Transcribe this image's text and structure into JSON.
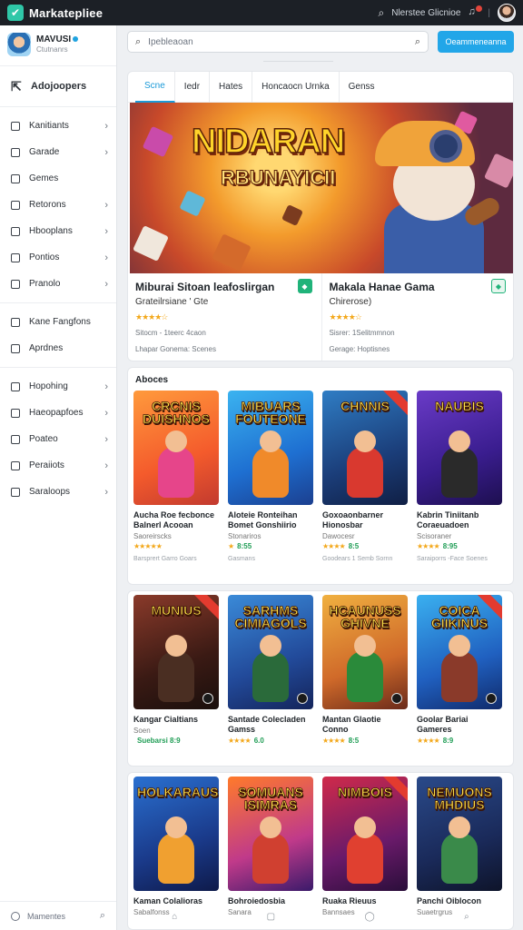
{
  "topbar": {
    "app_title": "Markatepliee",
    "user_text": "Nlerstee Glicnioe",
    "icons": [
      "search-icon",
      "bell-icon",
      "avatar"
    ],
    "accent": "#2fc7a8"
  },
  "sidebar": {
    "profile": {
      "name": "MAVUSI",
      "sub": "Ctutnanrs"
    },
    "back_label": "Adojoopers",
    "group1": [
      {
        "label": "Kanitiants",
        "chevron": true
      },
      {
        "label": "Garade",
        "chevron": true
      },
      {
        "label": "Gemes",
        "chevron": false
      },
      {
        "label": "Retorons",
        "chevron": true
      },
      {
        "label": "Hbooplans",
        "chevron": true
      },
      {
        "label": "Pontios",
        "chevron": true
      },
      {
        "label": "Pranolo",
        "chevron": true
      }
    ],
    "group2": [
      {
        "label": "Kane Fangfons",
        "chevron": false
      },
      {
        "label": "Aprdnes",
        "chevron": false
      }
    ],
    "group3": [
      {
        "label": "Hopohing",
        "chevron": true
      },
      {
        "label": "Haeopapfoes",
        "chevron": true
      },
      {
        "label": "Poateo",
        "chevron": true
      },
      {
        "label": "Peraiiots",
        "chevron": true
      },
      {
        "label": "Saraloops",
        "chevron": true
      }
    ],
    "footer_label": "Mamentes"
  },
  "search": {
    "placeholder": "Ipebleaoan",
    "button_label": "Oeammeneanna"
  },
  "subtle_text": "———————————",
  "tabs": [
    "Scne",
    "Iedr",
    "Hates",
    "Honcaocn Urnka",
    "Genss"
  ],
  "active_tab": 0,
  "hero": {
    "title": "NIDARAN",
    "subtitle": "RBUNAYICII"
  },
  "featured": [
    {
      "title": "Miburai Sitoan leafoslirgan",
      "subtitle": "Grateilrsiane ' Gte",
      "stars": "★★★★☆",
      "meta1": "Sitocm - 1teerc 4caon",
      "meta2": "Lhapar Gonema: Scenes",
      "badge": "◆"
    },
    {
      "title": "Makala Hanae Gama",
      "subtitle": "Chirerose)",
      "stars": "★★★★☆",
      "meta1": "Sisrer: 1Selitmmnon",
      "meta2": "Gerage: Hoptisnes",
      "badge": "◆"
    }
  ],
  "section1": {
    "title": "Aboces",
    "cards": [
      {
        "thumb_text": "CRCNIS DUISHNOS",
        "title": "Aucha Roe fecbonce Balnerl Acooan",
        "sub": "Saoreirscks",
        "stars": "★★★★★",
        "price": "",
        "meta": "Barsprert Garro Goars",
        "ribbon": false
      },
      {
        "thumb_text": "MIBUARS FOUTEONE",
        "title": "Aloteie Ronteihan Bomet Gonshiirio",
        "sub": "Stonariros",
        "stars": "★",
        "price": "8:55",
        "meta": "Gasmans",
        "ribbon": false
      },
      {
        "thumb_text": "CHNNIS",
        "title": "Goxoaonbarner Hionosbar",
        "sub": "Dawocesr",
        "stars": "★★★★",
        "price": "8:5",
        "meta": "Goodears 1 Semb Sornn",
        "ribbon": true
      },
      {
        "thumb_text": "NAUBIS",
        "title": "Kabrin Tiniitanb Coraeuadoen",
        "sub": "Scisoraner",
        "stars": "★★★★",
        "price": "8:95",
        "meta": "Saraiporrs -Face Soenes",
        "ribbon": false
      }
    ]
  },
  "section2": {
    "cards": [
      {
        "thumb_text": "MUNIUS",
        "title": "Kangar Cialtians",
        "sub": "Soen",
        "stars": "",
        "price": "Suebarsi 8:9",
        "meta": "",
        "ribbon": true
      },
      {
        "thumb_text": "SARHMS CIMIAGOLS",
        "title": "Santade Colecladen Gamss",
        "sub": "",
        "stars": "★★★★",
        "price": "6.0",
        "meta": "",
        "ribbon": false
      },
      {
        "thumb_text": "HCAUNUSS GHIVNE",
        "title": "Mantan Glaotie Conno",
        "sub": "",
        "stars": "★★★★",
        "price": "8:5",
        "meta": "",
        "ribbon": false
      },
      {
        "thumb_text": "COICA GIIKINUS",
        "title": "Goolar Bariai Gameres",
        "sub": "",
        "stars": "★★★★",
        "price": "8:9",
        "meta": "",
        "ribbon": true
      }
    ]
  },
  "section3": {
    "cards": [
      {
        "thumb_text": "HOLKARAUS",
        "title": "Kaman Colalioras",
        "sub": "Sabalfonss",
        "ribbon": false
      },
      {
        "thumb_text": "SOMUANS ISIMRAS",
        "title": "Bohroiedosbia",
        "sub": "Sanara",
        "ribbon": false
      },
      {
        "thumb_text": "NIMBOIS",
        "title": "Ruaka Rieuus",
        "sub": "Bannsaes",
        "ribbon": true
      },
      {
        "thumb_text": "NEMUONS MHDIUS",
        "title": "Panchi Oiblocon",
        "sub": "Suaetrgrus",
        "ribbon": false
      }
    ]
  },
  "colors": {
    "primary": "#22a6e8",
    "star": "#f3a81b",
    "green": "#1f9d55",
    "dark": "#1c2026"
  }
}
